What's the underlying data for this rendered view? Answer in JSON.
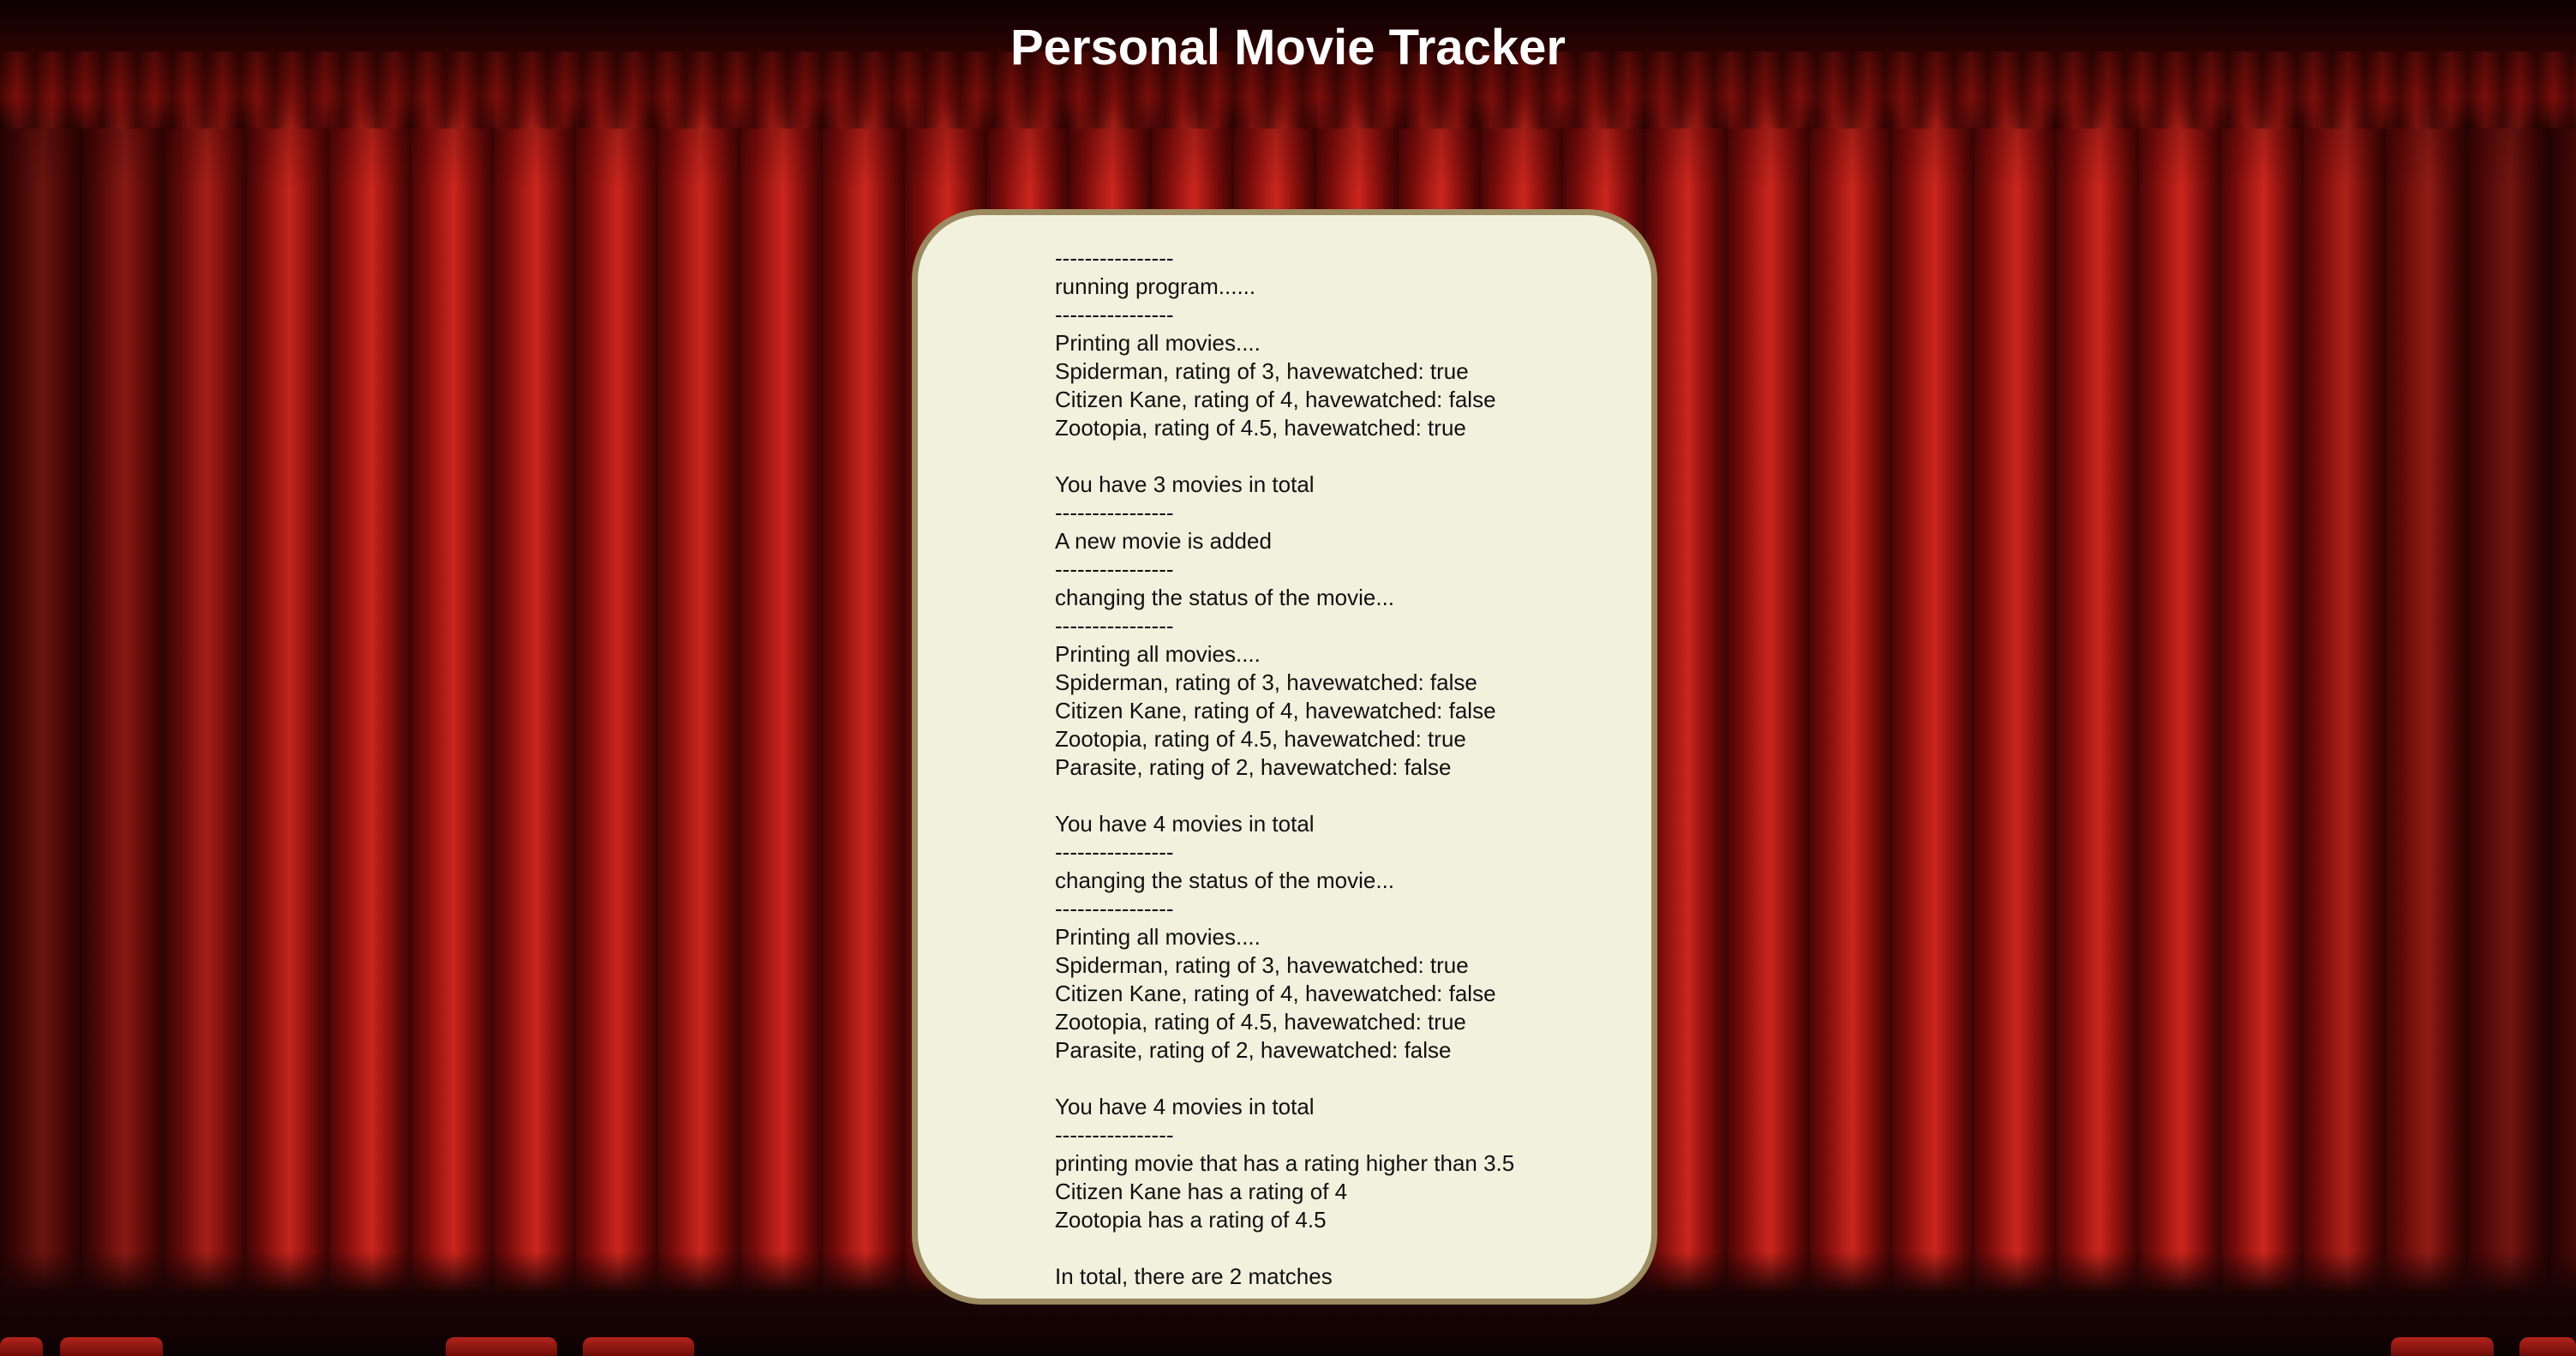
{
  "page": {
    "title": "Personal Movie Tracker"
  },
  "console": {
    "lines": [
      "----------------",
      "running program......",
      "----------------",
      "Printing all movies....",
      "Spiderman, rating of 3, havewatched: true",
      "Citizen Kane, rating of 4, havewatched: false",
      "Zootopia, rating of 4.5, havewatched: true",
      "",
      "You have 3 movies in total",
      "----------------",
      "A new movie is added",
      "----------------",
      "changing the status of the movie...",
      "----------------",
      "Printing all movies....",
      "Spiderman, rating of 3, havewatched: false",
      "Citizen Kane, rating of 4, havewatched: false",
      "Zootopia, rating of 4.5, havewatched: true",
      "Parasite, rating of 2, havewatched: false",
      "",
      "You have 4 movies in total",
      "----------------",
      "changing the status of the movie...",
      "----------------",
      "Printing all movies....",
      "Spiderman, rating of 3, havewatched: true",
      "Citizen Kane, rating of 4, havewatched: false",
      "Zootopia, rating of 4.5, havewatched: true",
      "Parasite, rating of 2, havewatched: false",
      "",
      "You have 4 movies in total",
      "----------------",
      "printing movie that has a rating higher than 3.5",
      "Citizen Kane has a rating of 4",
      "Zootopia has a rating of 4.5",
      "",
      "In total, there are 2 matches"
    ]
  },
  "colors": {
    "curtain": "#b01d17",
    "card_background": "#f2f1de",
    "card_border": "#9c8b60",
    "title_text": "#ffffff",
    "console_text": "#111111"
  }
}
